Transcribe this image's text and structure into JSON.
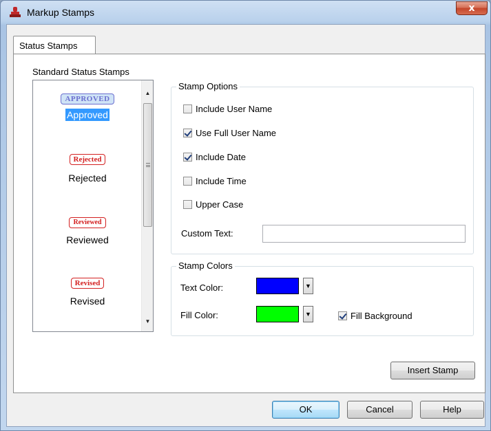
{
  "window": {
    "title": "Markup Stamps",
    "close_glyph": "x"
  },
  "tabs": [
    {
      "label": "Status Stamps",
      "active": true
    }
  ],
  "stamps_list": {
    "heading": "Standard Status Stamps",
    "items": [
      {
        "stamp_text": "APPROVED",
        "label": "Approved",
        "selected": true,
        "color": "#6b6fcf"
      },
      {
        "stamp_text": "Rejected",
        "label": "Rejected",
        "selected": false,
        "color": "#d31f1f"
      },
      {
        "stamp_text": "Reviewed",
        "label": "Reviewed",
        "selected": false,
        "color": "#d31f1f"
      },
      {
        "stamp_text": "Revised",
        "label": "Revised",
        "selected": false,
        "color": "#d31f1f"
      }
    ]
  },
  "stamp_options": {
    "title": "Stamp Options",
    "checkboxes": [
      {
        "label": "Include User Name",
        "checked": false
      },
      {
        "label": "Use Full User Name",
        "checked": true
      },
      {
        "label": "Include Date",
        "checked": true
      },
      {
        "label": "Include Time",
        "checked": false
      },
      {
        "label": "Upper Case",
        "checked": false
      }
    ],
    "custom_text_label": "Custom Text:",
    "custom_text_value": ""
  },
  "stamp_colors": {
    "title": "Stamp Colors",
    "text_color_label": "Text Color:",
    "text_color": "#0000ff",
    "fill_color_label": "Fill Color:",
    "fill_color": "#00ff00",
    "fill_background_label": "Fill Background",
    "fill_background_checked": true
  },
  "buttons": {
    "insert_stamp": "Insert Stamp",
    "ok": "OK",
    "cancel": "Cancel",
    "help": "Help"
  },
  "colors": {
    "selection": "#3399ff",
    "stamp_red": "#d31f1f"
  }
}
